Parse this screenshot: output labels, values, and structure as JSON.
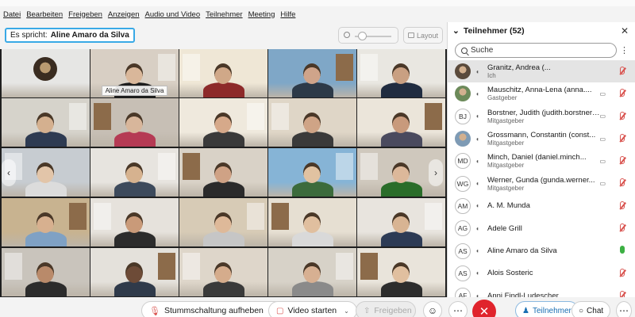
{
  "menu": [
    "Datei",
    "Bearbeiten",
    "Freigeben",
    "Anzeigen",
    "Audio und Video",
    "Teilnehmer",
    "Meeting",
    "Hilfe"
  ],
  "toolbar": {
    "speaker_prefix": "Es spricht:",
    "speaker_name": "Aline Amaro da Silva",
    "layout_label": "Layout"
  },
  "grid": {
    "active_label": "Aline Amaro da Silva"
  },
  "panel": {
    "title": "Teilnehmer (52)",
    "search_placeholder": "Suche",
    "participants": [
      {
        "name": "Granitz, Andrea (...",
        "role": "Ich",
        "avatar": "",
        "mic": "muted",
        "camera": false
      },
      {
        "name": "Mauschitz, Anna-Lena (anna....",
        "role": "Gastgeber",
        "avatar": "",
        "mic": "muted",
        "camera": true
      },
      {
        "name": "Borstner, Judith (judith.borstner@un...",
        "role": "Mitgastgeber",
        "avatar": "BJ",
        "mic": "muted",
        "camera": true
      },
      {
        "name": "Grossmann, Constantin (const...",
        "role": "Mitgastgeber",
        "avatar": "",
        "mic": "muted",
        "camera": true
      },
      {
        "name": "Minch, Daniel (daniel.minch...",
        "role": "Mitgastgeber",
        "avatar": "MD",
        "mic": "muted",
        "camera": true
      },
      {
        "name": "Werner, Gunda (gunda.werner...",
        "role": "Mitgastgeber",
        "avatar": "WG",
        "mic": "muted",
        "camera": true
      },
      {
        "name": "A. M. Munda",
        "role": "",
        "avatar": "AM",
        "mic": "muted",
        "camera": false
      },
      {
        "name": "Adele Grill",
        "role": "",
        "avatar": "AG",
        "mic": "muted",
        "camera": false
      },
      {
        "name": "Aline Amaro da Silva",
        "role": "",
        "avatar": "AS",
        "mic": "live",
        "camera": false
      },
      {
        "name": "Alois Sosteric",
        "role": "",
        "avatar": "AS",
        "mic": "muted",
        "camera": false
      },
      {
        "name": "Anni Findl-Ludescher",
        "role": "",
        "avatar": "AF",
        "mic": "muted",
        "camera": false
      }
    ]
  },
  "bottom": {
    "unmute_label": "Stummschaltung aufheben",
    "video_label": "Video starten",
    "share_label": "Freigeben",
    "participants_tab": "Teilnehmer",
    "chat_tab": "Chat"
  },
  "colors": {
    "accent": "#39a9e6",
    "leave": "#e0242c",
    "muted": "#d9534f",
    "live": "#3cb043"
  }
}
